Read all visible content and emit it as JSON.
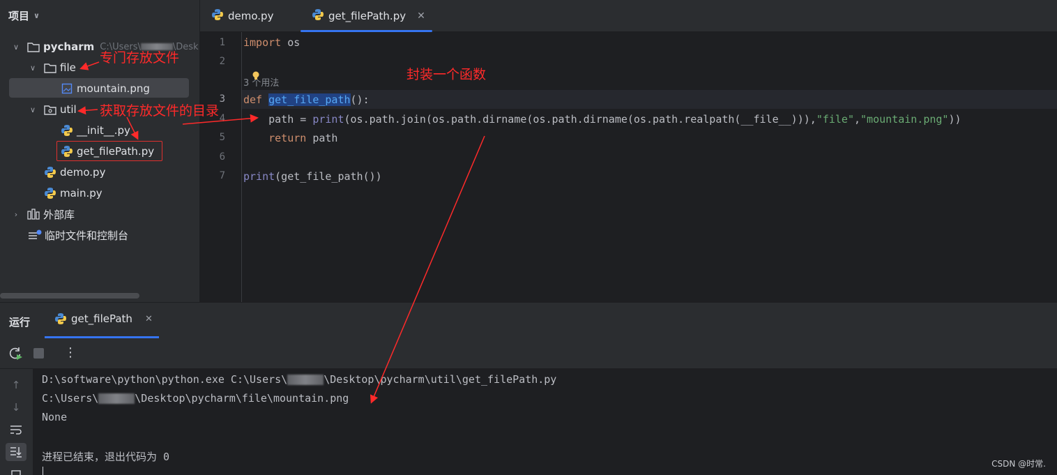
{
  "project_panel": {
    "title": "项目",
    "tree": [
      {
        "label": "pycharm",
        "path": "C:\\Users\\",
        "path_tail": "\\Desk"
      },
      {
        "label": "file"
      },
      {
        "label": "mountain.png"
      },
      {
        "label": "util"
      },
      {
        "label": "__init__.py"
      },
      {
        "label": "get_filePath.py"
      },
      {
        "label": "demo.py"
      },
      {
        "label": "main.py"
      },
      {
        "label": "外部库"
      },
      {
        "label": "临时文件和控制台"
      }
    ]
  },
  "editor": {
    "tabs": [
      {
        "label": "demo.py"
      },
      {
        "label": "get_filePath.py",
        "active": true
      }
    ],
    "line_numbers": [
      "1",
      "2",
      "3",
      "4",
      "5",
      "6",
      "7"
    ],
    "usage_hint": "3 个用法",
    "code": {
      "l1_kw": "import",
      "l1_rest": " os",
      "l3_kw": "def",
      "l3_fn": "get_file_path",
      "l3_rest": "():",
      "l4_a": "    path = ",
      "l4_print": "print",
      "l4_b": "(os.path.join(os.path.dirname(os.path.dirname(os.path.realpath(__file__))),",
      "l4_s1": "\"file\"",
      "l4_comma": ",",
      "l4_s2": "\"mountain.png\"",
      "l4_end": "))",
      "l5_kw": "    return",
      "l5_rest": " path",
      "l7_print": "print",
      "l7_rest": "(get_file_path())"
    }
  },
  "annotations": {
    "file_note": "专门存放文件",
    "util_note": "获取存放文件的目录",
    "func_note": "封装一个函数"
  },
  "run_panel": {
    "title": "运行",
    "tab_label": "get_filePath",
    "console": {
      "line1_a": "D:\\software\\python\\python.exe C:\\Users\\",
      "line1_b": "\\Desktop\\pycharm\\util\\get_filePath.py",
      "line2_a": "C:\\Users\\",
      "line2_b": "\\Desktop\\pycharm\\file\\mountain.png",
      "line3": "None",
      "line4": "进程已结束，退出代码为 0"
    }
  },
  "watermark": "CSDN @时常.",
  "colors": {
    "accent": "#3574f0",
    "annotation": "#ff2a2a",
    "keyword": "#cf8e6d",
    "function": "#56a8f5",
    "string": "#6aab73"
  }
}
